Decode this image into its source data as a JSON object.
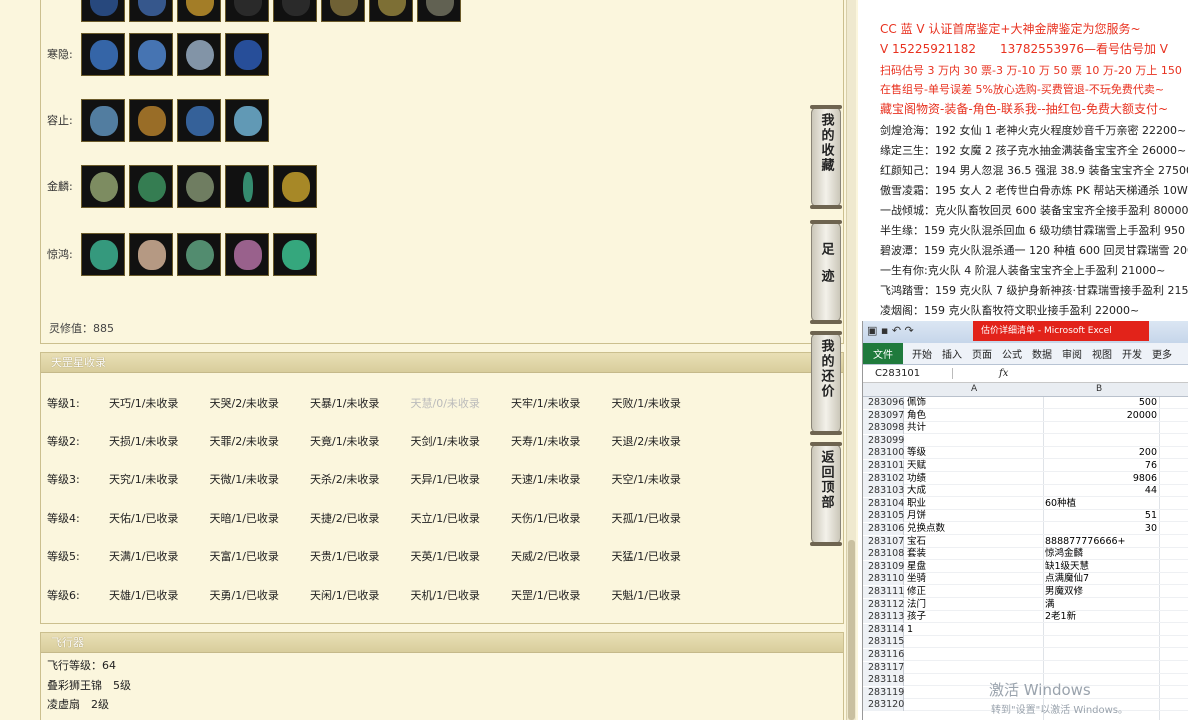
{
  "equipment": {
    "rows": [
      {
        "label": "",
        "count": 8
      },
      {
        "label": "寒隐:",
        "count": 4
      },
      {
        "label": "容止:",
        "count": 4
      },
      {
        "label": "金麟:",
        "count": 5
      },
      {
        "label": "惊鸿:",
        "count": 5
      }
    ],
    "ling_xiu": "灵修值：885"
  },
  "star_section": {
    "title": "天罡星收录",
    "rows": [
      {
        "level": "等级1:",
        "cells": [
          "天巧/1/未收录",
          "天哭/2/未收录",
          "天暴/1/未收录",
          "天慧/0/未收录",
          "天牢/1/未收录",
          "天败/1/未收录"
        ]
      },
      {
        "level": "等级2:",
        "cells": [
          "天损/1/未收录",
          "天罪/2/未收录",
          "天竟/1/未收录",
          "天剑/1/未收录",
          "天寿/1/未收录",
          "天退/2/未收录"
        ]
      },
      {
        "level": "等级3:",
        "cells": [
          "天究/1/未收录",
          "天微/1/未收录",
          "天杀/2/未收录",
          "天异/1/已收录",
          "天速/1/未收录",
          "天空/1/未收录"
        ]
      },
      {
        "level": "等级4:",
        "cells": [
          "天佑/1/已收录",
          "天暗/1/已收录",
          "天捷/2/已收录",
          "天立/1/已收录",
          "天伤/1/已收录",
          "天孤/1/已收录"
        ]
      },
      {
        "level": "等级5:",
        "cells": [
          "天满/1/已收录",
          "天富/1/已收录",
          "天贵/1/已收录",
          "天英/1/已收录",
          "天威/2/已收录",
          "天猛/1/已收录"
        ]
      },
      {
        "level": "等级6:",
        "cells": [
          "天雄/1/已收录",
          "天勇/1/已收录",
          "天闲/1/已收录",
          "天机/1/已收录",
          "天罡/1/已收录",
          "天魁/1/已收录"
        ]
      }
    ]
  },
  "fly_section": {
    "title": "飞行器",
    "lines": [
      "飞行等级：64",
      "叠彩狮王锦　5级",
      "凌虚扇　2级"
    ]
  },
  "side_buttons": [
    "我的收藏",
    "足迹",
    "我的还价",
    "返回顶部"
  ],
  "ads": [
    "CC 蓝 V 认证首席鉴定+大神金牌鉴定为您服务~",
    "V 15225921182　　13782553976—看号估号加 V",
    "扫码估号 3 万内 30 票-3 万-10 万 50 票 10 万-20 万上 150",
    "在售组号-单号误差 5%放心选购-买费管退-不玩免费代卖~",
    "藏宝阁物资-装备-角色-联系我--抽红包-免费大额支付~"
  ],
  "listings": [
    "剑煌沧海：192 女仙 1 老神火克火程度妙音千万亲密 22200~",
    "缘定三生：192 女魔 2 孩子克水抽金满装备宝宝齐全 26000~",
    "红颜知己：194 男人忽混 36.5 强混 38.9 装备宝宝齐全 27500~",
    "傲雪凌霜：195 女人 2 老传世白骨赤炼 PK 帮站天梯通杀 10W~",
    "一战倾城：克火队畜牧回灵 600 装备宝宝齐全接手盈利 80000",
    "半生缘：159 克火队混杀回血 6 级功绩甘霖瑞雪上手盈利 950",
    "碧波潭：159 克火队混杀通一 120 种植 600 回灵甘霖瑞雪 200",
    "一生有你:克火队 4 阶混人装备宝宝齐全上手盈利 21000~",
    "飞鸿踏雪：159 克火队 7 级护身新神孩·甘霖瑞雪接手盈利 215",
    "凌烟阁：159 克火队畜牧符文职业接手盈利 22000~"
  ],
  "excel": {
    "title": "估价详细清单 - Microsoft Excel",
    "tabs": [
      "开始",
      "插入",
      "页面",
      "公式",
      "数据",
      "审阅",
      "视图",
      "开发",
      "更多"
    ],
    "file_tab": "文件",
    "namebox": "C283101",
    "fx": "fx",
    "col_a": "A",
    "col_b": "B",
    "rows": [
      {
        "n": "283096",
        "a": "佩饰",
        "b": "500",
        "num": true
      },
      {
        "n": "283097",
        "a": "角色",
        "b": "20000",
        "num": true
      },
      {
        "n": "283098",
        "a": "共计",
        "b": "",
        "num": false
      },
      {
        "n": "283099",
        "a": "",
        "b": "",
        "num": false
      },
      {
        "n": "283100",
        "a": "等级",
        "b": "200",
        "num": true
      },
      {
        "n": "283101",
        "a": "天赋",
        "b": "76",
        "num": true
      },
      {
        "n": "283102",
        "a": "功绩",
        "b": "9806",
        "num": true
      },
      {
        "n": "283103",
        "a": "大成",
        "b": "44",
        "num": true
      },
      {
        "n": "283104",
        "a": "职业",
        "b": "60种植",
        "num": false
      },
      {
        "n": "283105",
        "a": "月饼",
        "b": "51",
        "num": true
      },
      {
        "n": "283106",
        "a": "兑换点数",
        "b": "30",
        "num": true
      },
      {
        "n": "283107",
        "a": "宝石",
        "b": "888877776666+",
        "num": false
      },
      {
        "n": "283108",
        "a": "套装",
        "b": "惊鸿金麟",
        "num": false
      },
      {
        "n": "283109",
        "a": "星盘",
        "b": "缺1级天慧",
        "num": false
      },
      {
        "n": "283110",
        "a": "坐骑",
        "b": "点满魔仙7",
        "num": false
      },
      {
        "n": "283111",
        "a": "修正",
        "b": "男魔双修",
        "num": false
      },
      {
        "n": "283112",
        "a": "法门",
        "b": "满",
        "num": false
      },
      {
        "n": "283113",
        "a": "孩子",
        "b": "2老1新",
        "num": false
      },
      {
        "n": "283114",
        "a": "1",
        "b": "",
        "num": false
      },
      {
        "n": "283115",
        "a": "",
        "b": "",
        "num": false
      },
      {
        "n": "283116",
        "a": "",
        "b": "",
        "num": false
      },
      {
        "n": "283117",
        "a": "",
        "b": "",
        "num": false
      },
      {
        "n": "283118",
        "a": "",
        "b": "",
        "num": false
      },
      {
        "n": "283119",
        "a": "",
        "b": "",
        "num": false
      },
      {
        "n": "283120",
        "a": "",
        "b": "",
        "num": false
      }
    ],
    "watermark": "激活 Windows",
    "watermark_sub": "转到\"设置\"以激活 Windows。"
  },
  "colors": {
    "panel_bg": "#fbf6dd",
    "ad_red": "#e8311f",
    "excel_green": "#1f7a3c",
    "excel_red": "#e2231a"
  }
}
